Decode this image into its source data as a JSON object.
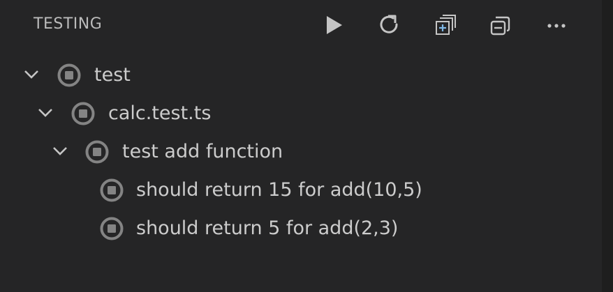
{
  "header": {
    "title": "TESTING",
    "actions": [
      {
        "name": "run-all-icon",
        "tooltip": "Run All Tests"
      },
      {
        "name": "refresh-icon",
        "tooltip": "Refresh Tests"
      },
      {
        "name": "expand-all-icon",
        "tooltip": "Expand All"
      },
      {
        "name": "collapse-all-icon",
        "tooltip": "Collapse All"
      },
      {
        "name": "more-actions-icon",
        "tooltip": "More Actions..."
      }
    ]
  },
  "tree": {
    "items": [
      {
        "label": "test",
        "depth": 0,
        "expandable": true,
        "expanded": true,
        "status": "unset"
      },
      {
        "label": "calc.test.ts",
        "depth": 1,
        "expandable": true,
        "expanded": true,
        "status": "unset"
      },
      {
        "label": "test add function",
        "depth": 2,
        "expandable": true,
        "expanded": true,
        "status": "unset"
      },
      {
        "label": "should return 15 for add(10,5)",
        "depth": 3,
        "expandable": false,
        "status": "unset"
      },
      {
        "label": "should return 5 for add(2,3)",
        "depth": 3,
        "expandable": false,
        "status": "unset"
      }
    ]
  },
  "colors": {
    "background": "#252526",
    "text": "#cccccc",
    "icon": "#c5c5c5",
    "status_unset": "#848484"
  }
}
